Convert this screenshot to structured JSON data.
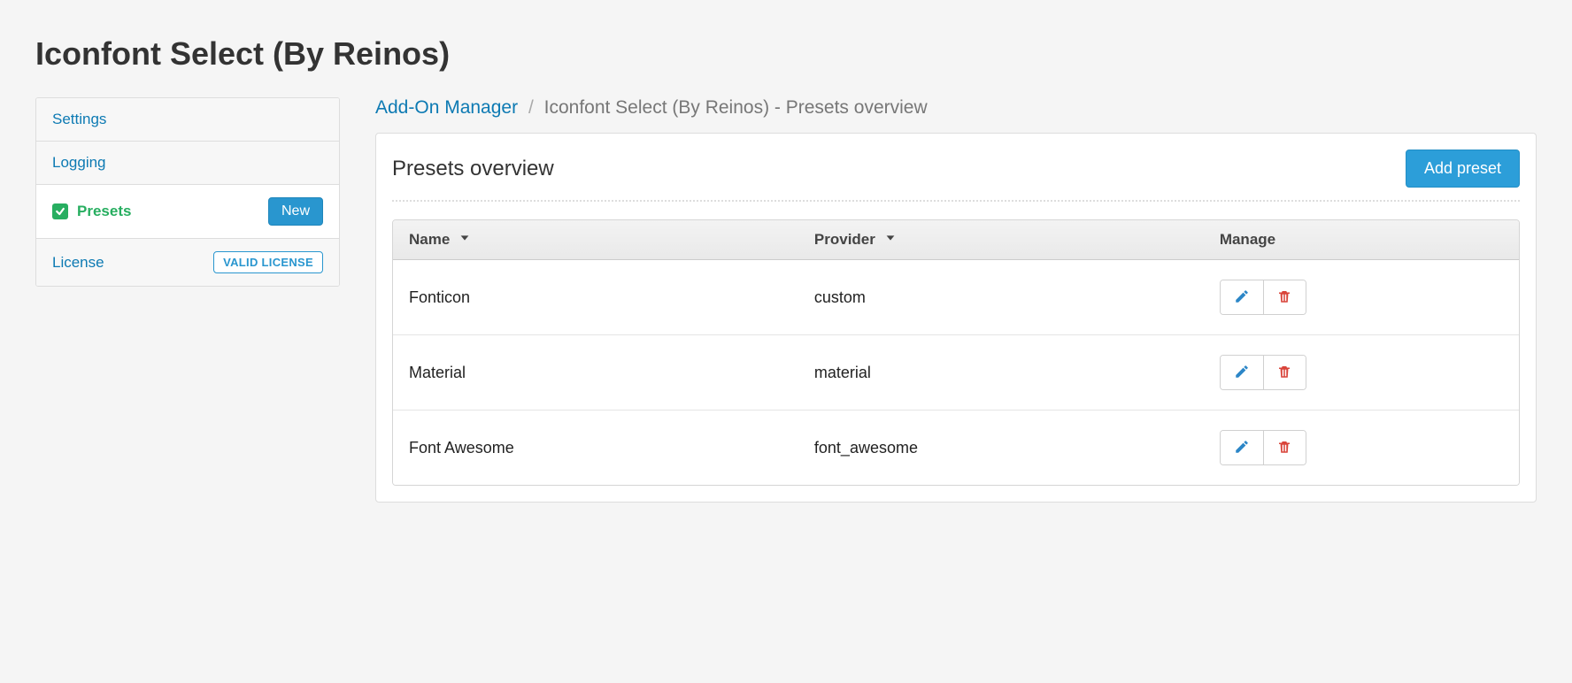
{
  "page": {
    "title": "Iconfont Select (By Reinos)"
  },
  "sidebar": {
    "items": [
      {
        "label": "Settings",
        "active": false
      },
      {
        "label": "Logging",
        "active": false
      },
      {
        "label": "Presets",
        "active": true,
        "button": "New"
      },
      {
        "label": "License",
        "active": false,
        "badge": "VALID LICENSE"
      }
    ]
  },
  "breadcrumb": {
    "root": "Add-On Manager",
    "current": "Iconfont Select (By Reinos) - Presets overview"
  },
  "panel": {
    "title": "Presets overview",
    "add_button": "Add preset"
  },
  "table": {
    "columns": {
      "name": "Name",
      "provider": "Provider",
      "manage": "Manage"
    },
    "rows": [
      {
        "name": "Fonticon",
        "provider": "custom"
      },
      {
        "name": "Material",
        "provider": "material"
      },
      {
        "name": "Font Awesome",
        "provider": "font_awesome"
      }
    ]
  }
}
